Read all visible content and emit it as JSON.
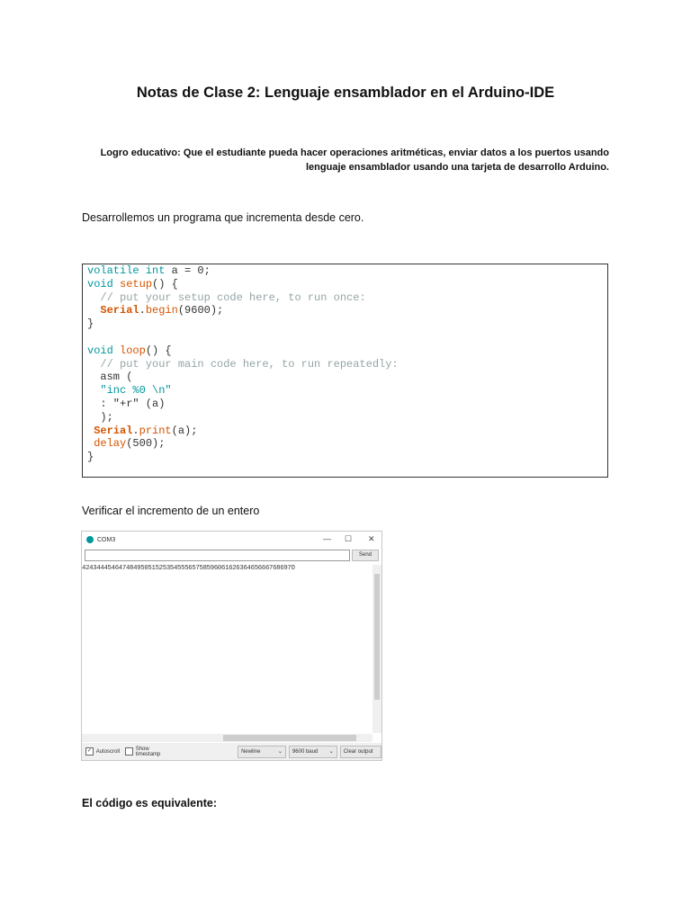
{
  "title": "Notas de Clase 2: Lenguaje ensamblador en el Arduino-IDE",
  "logro": {
    "line1": "Logro educativo: Que el estudiante pueda hacer operaciones aritméticas, enviar datos a los puertos usando",
    "line2": "lenguaje ensamblador usando una tarjeta de desarrollo Arduino."
  },
  "para1": "Desarrollemos un programa que incrementa desde cero.",
  "code": [
    [
      [
        "volatile int",
        "kw"
      ],
      [
        " a = 0;",
        "pl"
      ]
    ],
    [
      [
        "void ",
        "kw"
      ],
      [
        "setup",
        "fn"
      ],
      [
        "() {",
        "pl"
      ]
    ],
    [
      [
        "  // put your setup code here, to run once:",
        "cm"
      ]
    ],
    [
      [
        "  ",
        "pl"
      ],
      [
        "Serial",
        "obj"
      ],
      [
        ".",
        "pl"
      ],
      [
        "begin",
        "fn"
      ],
      [
        "(9600);",
        "pl"
      ]
    ],
    [
      [
        "}",
        "pl"
      ]
    ],
    [
      [
        "",
        "pl"
      ]
    ],
    [
      [
        "void ",
        "kw"
      ],
      [
        "loop",
        "fn"
      ],
      [
        "() {",
        "pl"
      ]
    ],
    [
      [
        "  // put your main code here, to run repeatedly:",
        "cm"
      ]
    ],
    [
      [
        "  asm (",
        "pl"
      ]
    ],
    [
      [
        "  \"inc %0 \\n\"",
        "str"
      ]
    ],
    [
      [
        "  : \"+r\" (a)",
        "pl"
      ]
    ],
    [
      [
        "  );",
        "pl"
      ]
    ],
    [
      [
        " ",
        "pl"
      ],
      [
        "Serial",
        "obj"
      ],
      [
        ".",
        "pl"
      ],
      [
        "print",
        "fn"
      ],
      [
        "(a);",
        "pl"
      ]
    ],
    [
      [
        " ",
        "pl"
      ],
      [
        "delay",
        "fn"
      ],
      [
        "(500);",
        "pl"
      ]
    ],
    [
      [
        "}",
        "pl"
      ]
    ]
  ],
  "para2": "Verificar el incremento de un entero",
  "monitor": {
    "title": "COM3",
    "minimize": "—",
    "maximize": "☐",
    "close": "✕",
    "input_value": "",
    "send": "Send",
    "output": "424344454647484950515253545556575859606162636465666768697O",
    "autoscroll": "Autoscroll",
    "autoscroll_checked": true,
    "timestamp": "Show timestamp",
    "line_ending": "Newline",
    "baud": "9600 baud",
    "clear": "Clear output"
  },
  "para3": "El código es equivalente:"
}
